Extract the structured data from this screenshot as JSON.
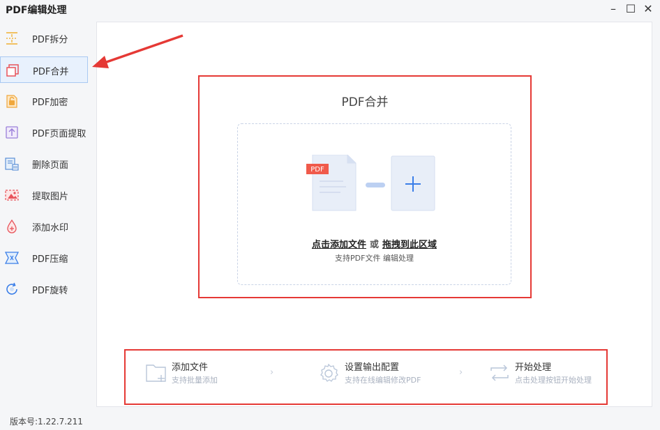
{
  "app": {
    "title": "PDF编辑处理",
    "version": "版本号:1.22.7.211"
  },
  "window_controls": {
    "minimize": "–",
    "maximize": "☐",
    "close": "✕"
  },
  "sidebar": {
    "items": [
      {
        "label": "PDF拆分"
      },
      {
        "label": "PDF合并",
        "active": true
      },
      {
        "label": "PDF加密"
      },
      {
        "label": "PDF页面提取"
      },
      {
        "label": "删除页面"
      },
      {
        "label": "提取图片"
      },
      {
        "label": "添加水印"
      },
      {
        "label": "PDF压缩"
      },
      {
        "label": "PDF旋转"
      }
    ]
  },
  "upload": {
    "title": "PDF合并",
    "badge": "PDF",
    "click_add": "点击添加文件",
    "or": "或",
    "drag_here": "拖拽到此区域",
    "sub": "支持PDF文件 编辑处理"
  },
  "steps": [
    {
      "title": "添加文件",
      "desc": "支持批量添加"
    },
    {
      "title": "设置输出配置",
      "desc": "支持在线编辑修改PDF"
    },
    {
      "title": "开始处理",
      "desc": "点击处理按钮开始处理"
    }
  ],
  "step_separator": "›",
  "colors": {
    "accent": "#3a7ee8",
    "highlight_red": "#e53935",
    "active_bg": "#e8f1fd",
    "pdf_badge": "#f05a4b"
  }
}
